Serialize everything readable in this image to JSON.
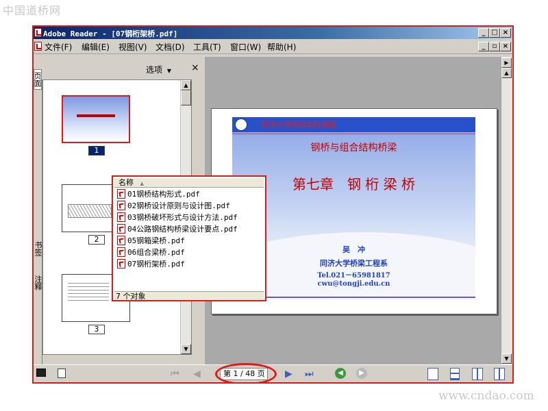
{
  "watermarks": {
    "top_left": "中国道桥网",
    "bottom_right": "www.cndao.com"
  },
  "window": {
    "title": "Adobe Reader - [07钢桁架桥.pdf]"
  },
  "menu": {
    "items": [
      {
        "label": "文件(F)"
      },
      {
        "label": "编辑(E)"
      },
      {
        "label": "视图(V)"
      },
      {
        "label": "文档(D)"
      },
      {
        "label": "工具(T)"
      },
      {
        "label": "窗口(W)"
      },
      {
        "label": "帮助(H)"
      }
    ]
  },
  "side_tabs": {
    "pages": "页面",
    "bookmarks": "书签",
    "comments": "注释"
  },
  "thumb_panel": {
    "options_label": "选项",
    "close_glyph": "×",
    "pages": [
      "1",
      "2",
      "3"
    ]
  },
  "slide": {
    "header": "同济大学桥梁本科课程",
    "subtitle": "钢桥与组合结构桥梁",
    "title": "第七章　钢 桁 梁 桥",
    "author": "吴　冲",
    "org": "同济大学桥梁工程系",
    "tel": "Tel.021－65981817",
    "email": "cwu@tongji.edu.cn"
  },
  "file_list": {
    "column_header": "名称",
    "files": [
      "01钢桥结构形式.pdf",
      "02钢桥设计原则与设计图.pdf",
      "03钢桥破坏形式与设计方法.pdf",
      "04公路钢结构桥梁设计要点.pdf",
      "05钢箱梁桥.pdf",
      "06组合梁桥.pdf",
      "07钢桁架桥.pdf"
    ],
    "status": "7 个对象"
  },
  "statusbar": {
    "page_indicator": "第 1 / 48 页"
  },
  "colors": {
    "highlight": "#e01818",
    "slide_title": "#c00000",
    "slide_blue": "#2040c0"
  }
}
